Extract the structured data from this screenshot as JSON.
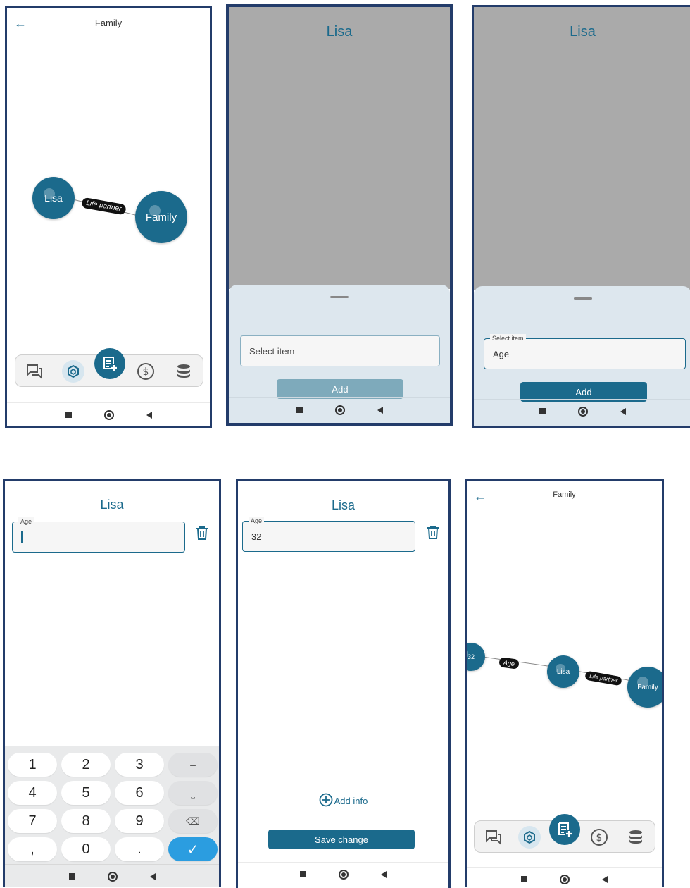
{
  "screen1": {
    "title": "Family",
    "nodes": [
      {
        "label": "Lisa"
      },
      {
        "label": "Family"
      }
    ],
    "edge_label": "Life partner",
    "toolbar": {
      "icons": [
        "chat-icon",
        "cube-icon",
        "note-add-icon",
        "dollar-icon",
        "database-icon"
      ]
    }
  },
  "screen2": {
    "title": "Lisa",
    "field_placeholder": "Select item",
    "add_label": "Add"
  },
  "screen3": {
    "title": "Lisa",
    "field_label": "Select item",
    "field_value": "Age",
    "add_label": "Add"
  },
  "screen4": {
    "title": "Lisa",
    "field_label": "Age",
    "field_value": "",
    "keys": [
      [
        "1",
        "2",
        "3",
        "–"
      ],
      [
        "4",
        "5",
        "6",
        "⎵"
      ],
      [
        "7",
        "8",
        "9",
        "⌫"
      ],
      [
        ",",
        "0",
        ".",
        "✓"
      ]
    ]
  },
  "screen5": {
    "title": "Lisa",
    "field_label": "Age",
    "field_value": "32",
    "add_info_label": "Add info",
    "save_label": "Save change"
  },
  "screen6": {
    "title": "Family",
    "nodes": [
      {
        "label": "32"
      },
      {
        "label": "Lisa"
      },
      {
        "label": "Family"
      }
    ],
    "edge_labels": [
      "Age",
      "Life partner"
    ]
  },
  "colors": {
    "accent": "#1b6a8c",
    "frame": "#233c6a",
    "disabled_button": "#7eaabb",
    "sheet": "#dde7ee",
    "overlay": "#aaaaaa",
    "keyboard_action": "#2b9de0"
  }
}
